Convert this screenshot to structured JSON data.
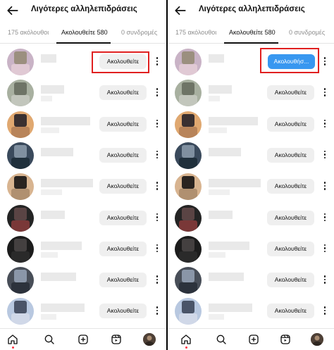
{
  "screen": {
    "title": "Λιγότερες αλληλεπιδράσεις",
    "tabs": [
      {
        "label": "175 ακόλουθοι"
      },
      {
        "label": "Ακολουθείτε 580"
      },
      {
        "label": "0 συνδρομές"
      }
    ],
    "active_tab": "Ακολουθείτε 580"
  },
  "left_panel": {
    "rows": [
      {
        "button": "Ακολουθείτε"
      },
      {
        "button": "Ακολουθείτε"
      },
      {
        "button": "Ακολουθείτε"
      },
      {
        "button": "Ακολουθείτε"
      },
      {
        "button": "Ακολουθείτε"
      },
      {
        "button": "Ακολουθείτε"
      },
      {
        "button": "Ακολουθείτε"
      },
      {
        "button": "Ακολουθείτε"
      },
      {
        "button": "Ακολουθείτε"
      }
    ],
    "highlighted_row": 0
  },
  "right_panel": {
    "rows": [
      {
        "button": "Ακολουθήσ..."
      },
      {
        "button": "Ακολουθείτε"
      },
      {
        "button": "Ακολουθείτε"
      },
      {
        "button": "Ακολουθείτε"
      },
      {
        "button": "Ακολουθείτε"
      },
      {
        "button": "Ακολουθείτε"
      },
      {
        "button": "Ακολουθείτε"
      },
      {
        "button": "Ακολουθείτε"
      },
      {
        "button": "Ακολουθείτε"
      }
    ],
    "highlighted_row": 0
  },
  "bottom_nav": {
    "items": [
      {
        "icon": "home-icon"
      },
      {
        "icon": "search-icon"
      },
      {
        "icon": "create-icon"
      },
      {
        "icon": "reels-icon"
      },
      {
        "icon": "profile-avatar"
      }
    ]
  },
  "colors": {
    "highlight": "#e02020",
    "primary_blue": "#3897f0",
    "button_gray": "#efefef",
    "notification_dot": "#ff3040"
  }
}
